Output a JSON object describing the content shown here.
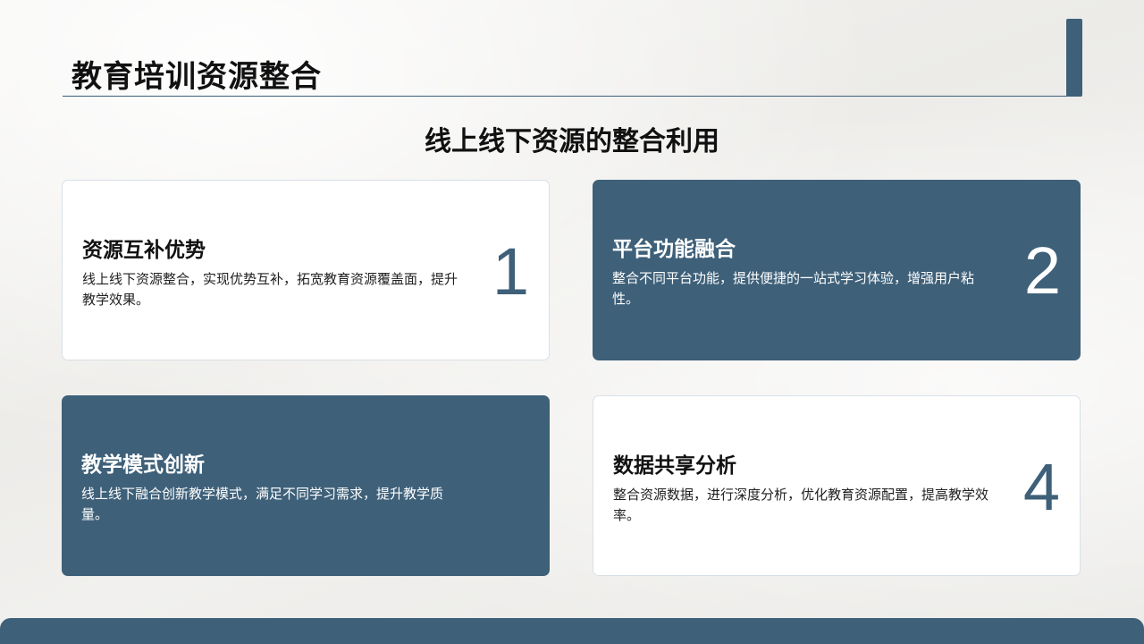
{
  "title": "教育培训资源整合",
  "subtitle": "线上线下资源的整合利用",
  "colors": {
    "accent": "#3e6079",
    "card_light": "#ffffff",
    "text_dark": "#111111"
  },
  "cards": [
    {
      "title": "资源互补优势",
      "description": "线上线下资源整合，实现优势互补，拓宽教育资源覆盖面，提升教学效果。",
      "number": "1",
      "style": "light"
    },
    {
      "title": "平台功能融合",
      "description": "整合不同平台功能，提供便捷的一站式学习体验，增强用户粘性。",
      "number": "2",
      "style": "dark"
    },
    {
      "title": "教学模式创新",
      "description": "线上线下融合创新教学模式，满足不同学习需求，提升教学质量。",
      "number": "",
      "style": "dark"
    },
    {
      "title": "数据共享分析",
      "description": "整合资源数据，进行深度分析，优化教育资源配置，提高教学效率。",
      "number": "4",
      "style": "light"
    }
  ]
}
